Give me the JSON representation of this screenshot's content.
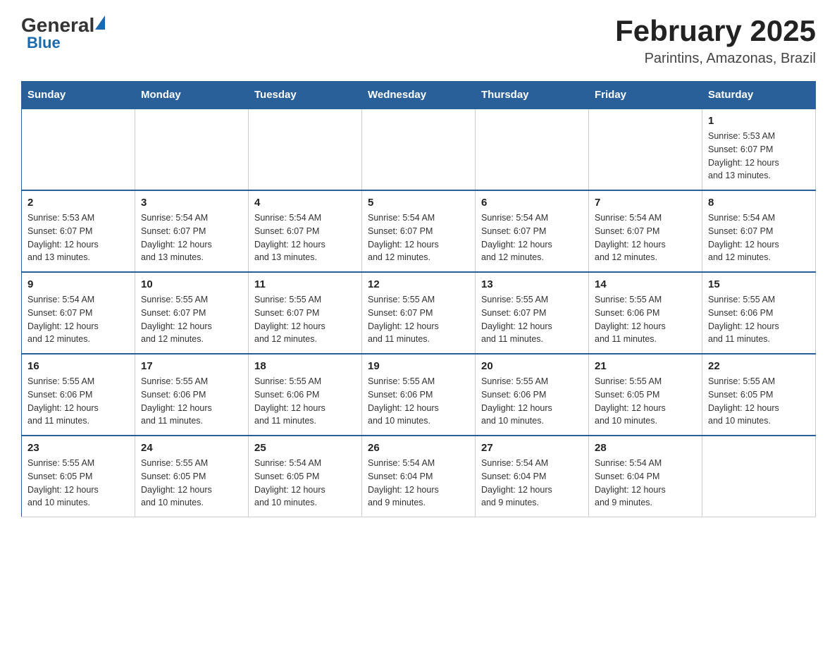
{
  "header": {
    "logo_general": "General",
    "logo_blue": "Blue",
    "month_title": "February 2025",
    "location": "Parintins, Amazonas, Brazil"
  },
  "weekdays": [
    "Sunday",
    "Monday",
    "Tuesday",
    "Wednesday",
    "Thursday",
    "Friday",
    "Saturday"
  ],
  "weeks": [
    [
      {
        "day": "",
        "info": ""
      },
      {
        "day": "",
        "info": ""
      },
      {
        "day": "",
        "info": ""
      },
      {
        "day": "",
        "info": ""
      },
      {
        "day": "",
        "info": ""
      },
      {
        "day": "",
        "info": ""
      },
      {
        "day": "1",
        "info": "Sunrise: 5:53 AM\nSunset: 6:07 PM\nDaylight: 12 hours\nand 13 minutes."
      }
    ],
    [
      {
        "day": "2",
        "info": "Sunrise: 5:53 AM\nSunset: 6:07 PM\nDaylight: 12 hours\nand 13 minutes."
      },
      {
        "day": "3",
        "info": "Sunrise: 5:54 AM\nSunset: 6:07 PM\nDaylight: 12 hours\nand 13 minutes."
      },
      {
        "day": "4",
        "info": "Sunrise: 5:54 AM\nSunset: 6:07 PM\nDaylight: 12 hours\nand 13 minutes."
      },
      {
        "day": "5",
        "info": "Sunrise: 5:54 AM\nSunset: 6:07 PM\nDaylight: 12 hours\nand 12 minutes."
      },
      {
        "day": "6",
        "info": "Sunrise: 5:54 AM\nSunset: 6:07 PM\nDaylight: 12 hours\nand 12 minutes."
      },
      {
        "day": "7",
        "info": "Sunrise: 5:54 AM\nSunset: 6:07 PM\nDaylight: 12 hours\nand 12 minutes."
      },
      {
        "day": "8",
        "info": "Sunrise: 5:54 AM\nSunset: 6:07 PM\nDaylight: 12 hours\nand 12 minutes."
      }
    ],
    [
      {
        "day": "9",
        "info": "Sunrise: 5:54 AM\nSunset: 6:07 PM\nDaylight: 12 hours\nand 12 minutes."
      },
      {
        "day": "10",
        "info": "Sunrise: 5:55 AM\nSunset: 6:07 PM\nDaylight: 12 hours\nand 12 minutes."
      },
      {
        "day": "11",
        "info": "Sunrise: 5:55 AM\nSunset: 6:07 PM\nDaylight: 12 hours\nand 12 minutes."
      },
      {
        "day": "12",
        "info": "Sunrise: 5:55 AM\nSunset: 6:07 PM\nDaylight: 12 hours\nand 11 minutes."
      },
      {
        "day": "13",
        "info": "Sunrise: 5:55 AM\nSunset: 6:07 PM\nDaylight: 12 hours\nand 11 minutes."
      },
      {
        "day": "14",
        "info": "Sunrise: 5:55 AM\nSunset: 6:06 PM\nDaylight: 12 hours\nand 11 minutes."
      },
      {
        "day": "15",
        "info": "Sunrise: 5:55 AM\nSunset: 6:06 PM\nDaylight: 12 hours\nand 11 minutes."
      }
    ],
    [
      {
        "day": "16",
        "info": "Sunrise: 5:55 AM\nSunset: 6:06 PM\nDaylight: 12 hours\nand 11 minutes."
      },
      {
        "day": "17",
        "info": "Sunrise: 5:55 AM\nSunset: 6:06 PM\nDaylight: 12 hours\nand 11 minutes."
      },
      {
        "day": "18",
        "info": "Sunrise: 5:55 AM\nSunset: 6:06 PM\nDaylight: 12 hours\nand 11 minutes."
      },
      {
        "day": "19",
        "info": "Sunrise: 5:55 AM\nSunset: 6:06 PM\nDaylight: 12 hours\nand 10 minutes."
      },
      {
        "day": "20",
        "info": "Sunrise: 5:55 AM\nSunset: 6:06 PM\nDaylight: 12 hours\nand 10 minutes."
      },
      {
        "day": "21",
        "info": "Sunrise: 5:55 AM\nSunset: 6:05 PM\nDaylight: 12 hours\nand 10 minutes."
      },
      {
        "day": "22",
        "info": "Sunrise: 5:55 AM\nSunset: 6:05 PM\nDaylight: 12 hours\nand 10 minutes."
      }
    ],
    [
      {
        "day": "23",
        "info": "Sunrise: 5:55 AM\nSunset: 6:05 PM\nDaylight: 12 hours\nand 10 minutes."
      },
      {
        "day": "24",
        "info": "Sunrise: 5:55 AM\nSunset: 6:05 PM\nDaylight: 12 hours\nand 10 minutes."
      },
      {
        "day": "25",
        "info": "Sunrise: 5:54 AM\nSunset: 6:05 PM\nDaylight: 12 hours\nand 10 minutes."
      },
      {
        "day": "26",
        "info": "Sunrise: 5:54 AM\nSunset: 6:04 PM\nDaylight: 12 hours\nand 9 minutes."
      },
      {
        "day": "27",
        "info": "Sunrise: 5:54 AM\nSunset: 6:04 PM\nDaylight: 12 hours\nand 9 minutes."
      },
      {
        "day": "28",
        "info": "Sunrise: 5:54 AM\nSunset: 6:04 PM\nDaylight: 12 hours\nand 9 minutes."
      },
      {
        "day": "",
        "info": ""
      }
    ]
  ]
}
